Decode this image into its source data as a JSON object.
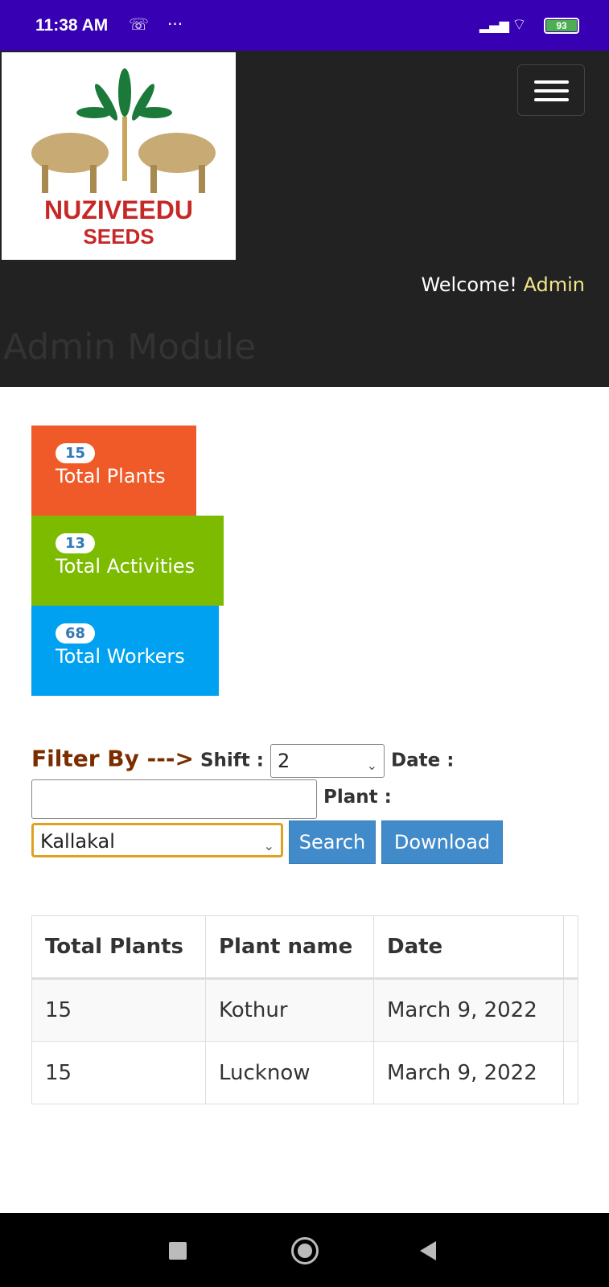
{
  "status_bar": {
    "time": "11:38 AM",
    "battery": "93"
  },
  "header": {
    "logo_text": "NUZIVEEDU",
    "logo_sub": "SEEDS",
    "welcome": "Welcome!",
    "user": "Admin",
    "module_title": "Admin Module"
  },
  "cards": [
    {
      "count": "15",
      "label": "Total Plants",
      "color": "#f05a28"
    },
    {
      "count": "13",
      "label": "Total Activities",
      "color": "#7cbb00"
    },
    {
      "count": "68",
      "label": "Total Workers",
      "color": "#00a1f1"
    }
  ],
  "filter": {
    "title": "Filter By --->",
    "shift_label": "Shift :",
    "shift_value": "2",
    "date_label": "Date :",
    "date_value": "",
    "plant_label": "Plant :",
    "plant_value": "Kallakal",
    "search": "Search",
    "download": "Download"
  },
  "table": {
    "headers": [
      "Total Plants",
      "Plant name",
      "Date"
    ],
    "rows": [
      [
        "15",
        "Kothur",
        "March 9, 2022"
      ],
      [
        "15",
        "Lucknow",
        "March 9, 2022"
      ]
    ]
  }
}
